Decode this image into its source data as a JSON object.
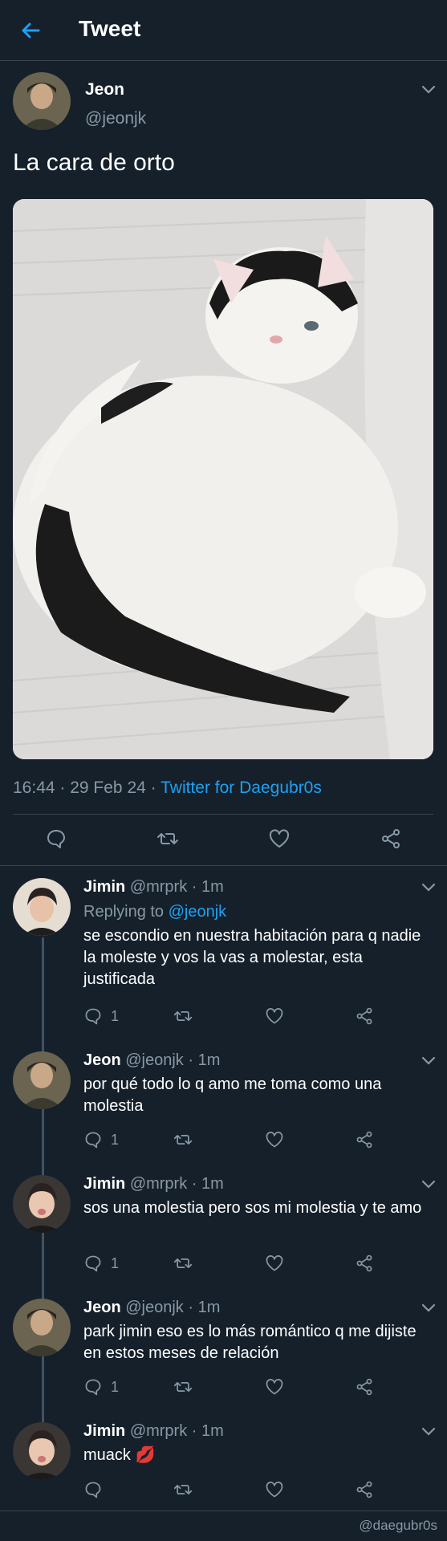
{
  "header": {
    "title": "Tweet",
    "back_icon": "arrow-left-icon"
  },
  "tweet": {
    "name": "Jeon",
    "handle": "@jeonjk",
    "text": "La cara de orto",
    "time": "16:44",
    "date": "29 Feb 24",
    "source": "Twitter for Daegubr0s"
  },
  "replies": [
    {
      "name": "Jimin",
      "handle": "@mrprk",
      "time": "1m",
      "replying_label": "Replying to",
      "replying_handle": "@jeonjk",
      "text": "se escondio en nuestra habitación para q nadie la moleste y vos la vas a molestar, esta justificada",
      "reply_count": "1"
    },
    {
      "name": "Jeon",
      "handle": "@jeonjk",
      "time": "1m",
      "text": "por qué todo lo q amo me toma como una molestia",
      "reply_count": "1"
    },
    {
      "name": "Jimin",
      "handle": "@mrprk",
      "time": "1m",
      "text": "sos una molestia pero sos mi molestia y te amo",
      "reply_count": "1"
    },
    {
      "name": "Jeon",
      "handle": "@jeonjk",
      "time": "1m",
      "text": "park jimin eso es lo más romántico q me dijiste en estos meses de relación",
      "reply_count": "1"
    },
    {
      "name": "Jimin",
      "handle": "@mrprk",
      "time": "1m",
      "text": "muack 💋",
      "reply_count": ""
    }
  ],
  "watermark": "@daegubr0s",
  "colors": {
    "background": "#15202b",
    "accent": "#1da1f2",
    "muted": "#8899a6",
    "divider": "#38444d"
  }
}
